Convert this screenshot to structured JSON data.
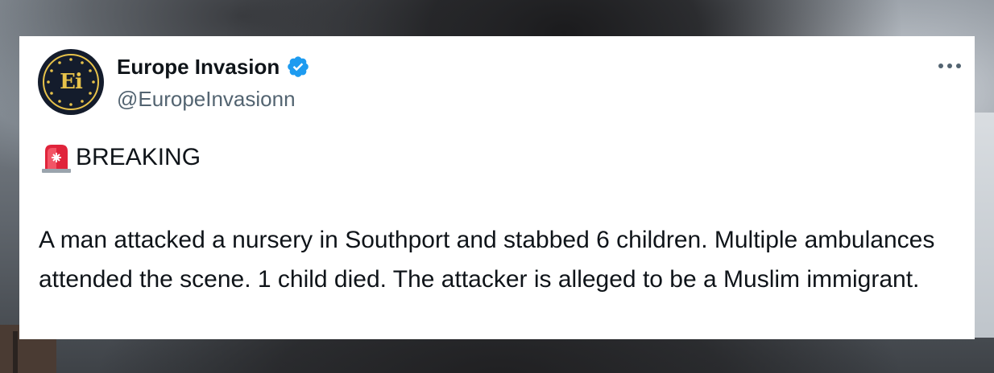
{
  "background": {
    "description_colors": {
      "smoke_dark": "#1b1b1d",
      "sky_light": "#d5dae0"
    }
  },
  "tweet": {
    "author": {
      "display_name": "Europe Invasion",
      "handle": "@EuropeInvasionn",
      "verified": true,
      "avatar_initials": "Ei",
      "avatar_bg_color": "#141c2c",
      "avatar_accent_color": "#e7c24a"
    },
    "more_options_icon": "more-horizontal-icon",
    "verified_badge_color": "#1d9bf0",
    "breaking_label": "BREAKING",
    "breaking_emoji": "police-car-light-icon",
    "body": "A man attacked a nursery in Southport and stabbed 6 children. Multiple ambulances attended the scene. 1 child died. The attacker is alleged to be a Muslim immigrant."
  }
}
